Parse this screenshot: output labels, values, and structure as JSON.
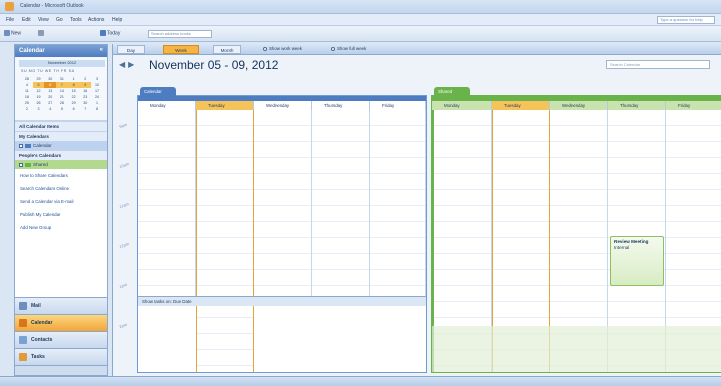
{
  "app": {
    "title": "Calendar - Microsoft Outlook"
  },
  "menu": [
    "File",
    "Edit",
    "View",
    "Go",
    "Tools",
    "Actions",
    "Help"
  ],
  "help_placeholder": "Type a question for help",
  "toolbar": {
    "new_label": "New",
    "print_label": "",
    "today_label": "Today",
    "search_placeholder": "Search address books"
  },
  "nav": {
    "title": "Calendar",
    "mini_cal_month": "November 2012",
    "mini_cal_dows": "SU MO TU WE TH FR SA",
    "mini_cal_rows": [
      [
        "28",
        "29",
        "30",
        "31",
        "1",
        "2",
        "3"
      ],
      [
        "4",
        "5",
        "6",
        "7",
        "8",
        "9",
        "10"
      ],
      [
        "11",
        "12",
        "13",
        "14",
        "15",
        "16",
        "17"
      ],
      [
        "18",
        "19",
        "20",
        "21",
        "22",
        "23",
        "24"
      ],
      [
        "25",
        "26",
        "27",
        "28",
        "29",
        "30",
        "1"
      ],
      [
        "2",
        "3",
        "4",
        "5",
        "6",
        "7",
        "8"
      ]
    ],
    "all_items": "All Calendar Items",
    "my_calendars_hdr": "My Calendars",
    "my_calendar": "Calendar",
    "shared_hdr": "People's Calendars",
    "shared_calendar": "Shared",
    "links": [
      "How to Share Calendars",
      "Search Calendars Online",
      "Send a Calendar via E-mail",
      "Publish My Calendar",
      "Add New Group"
    ],
    "buttons": [
      "Mail",
      "Calendar",
      "Contacts",
      "Tasks"
    ]
  },
  "view": {
    "tabs": [
      "Day",
      "Week",
      "Month"
    ],
    "radio_show": "Show work week",
    "radio_full": "Show full week",
    "date_range": "November 05 - 09, 2012",
    "search_placeholder": "Search Calendar"
  },
  "panels": [
    {
      "tab": "Calendar",
      "days": [
        "Monday",
        "Tuesday",
        "Wednesday",
        "Thursday",
        "Friday"
      ]
    },
    {
      "tab": "Shared",
      "days": [
        "Monday",
        "Tuesday",
        "Wednesday",
        "Thursday",
        "Friday"
      ]
    }
  ],
  "tasks_label": "Show tasks on: Due Date",
  "event": {
    "title": "Review Meeting",
    "subtitle": "Internal"
  },
  "colors": {
    "accent": "#f6b442",
    "blue": "#4d7cc0",
    "green": "#6ab34a"
  }
}
